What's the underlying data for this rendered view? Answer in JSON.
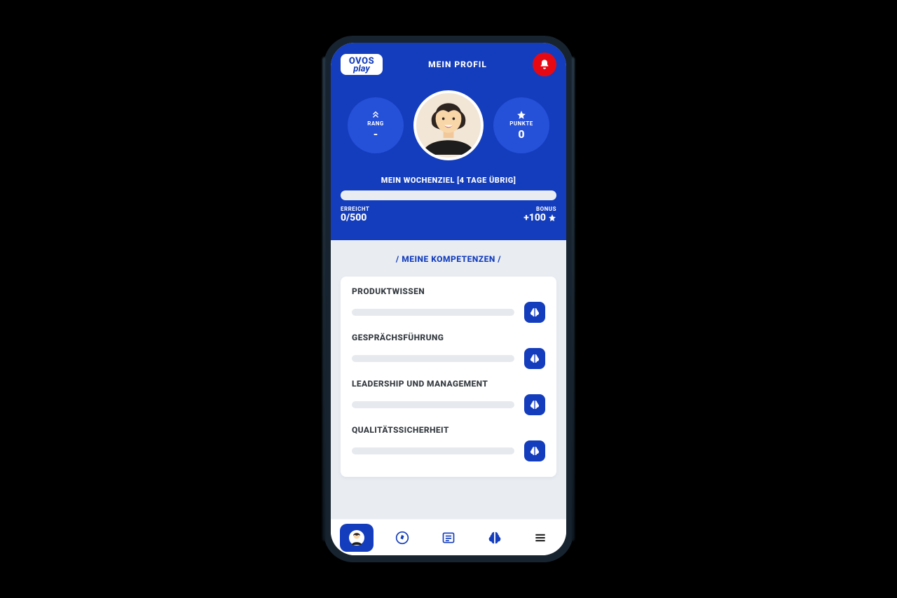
{
  "logo": {
    "line1": "OVOS",
    "line2": "play"
  },
  "header": {
    "title": "MEIN PROFIL"
  },
  "stats": {
    "rank": {
      "label": "RANG",
      "value": "-"
    },
    "points": {
      "label": "PUNKTE",
      "value": "0"
    }
  },
  "goal": {
    "title": "MEIN WOCHENZIEL [4 TAGE ÜBRIG]",
    "reached_label": "ERREICHT",
    "reached_value": "0/500",
    "bonus_label": "BONUS",
    "bonus_value": "+100"
  },
  "section": {
    "title": "/ MEINE KOMPETENZEN /"
  },
  "competencies": [
    {
      "title": "PRODUKTWISSEN"
    },
    {
      "title": "GESPRÄCHSFÜHRUNG"
    },
    {
      "title": "LEADERSHIP UND MANAGEMENT"
    },
    {
      "title": "QUALITÄTSSICHERHEIT"
    }
  ]
}
